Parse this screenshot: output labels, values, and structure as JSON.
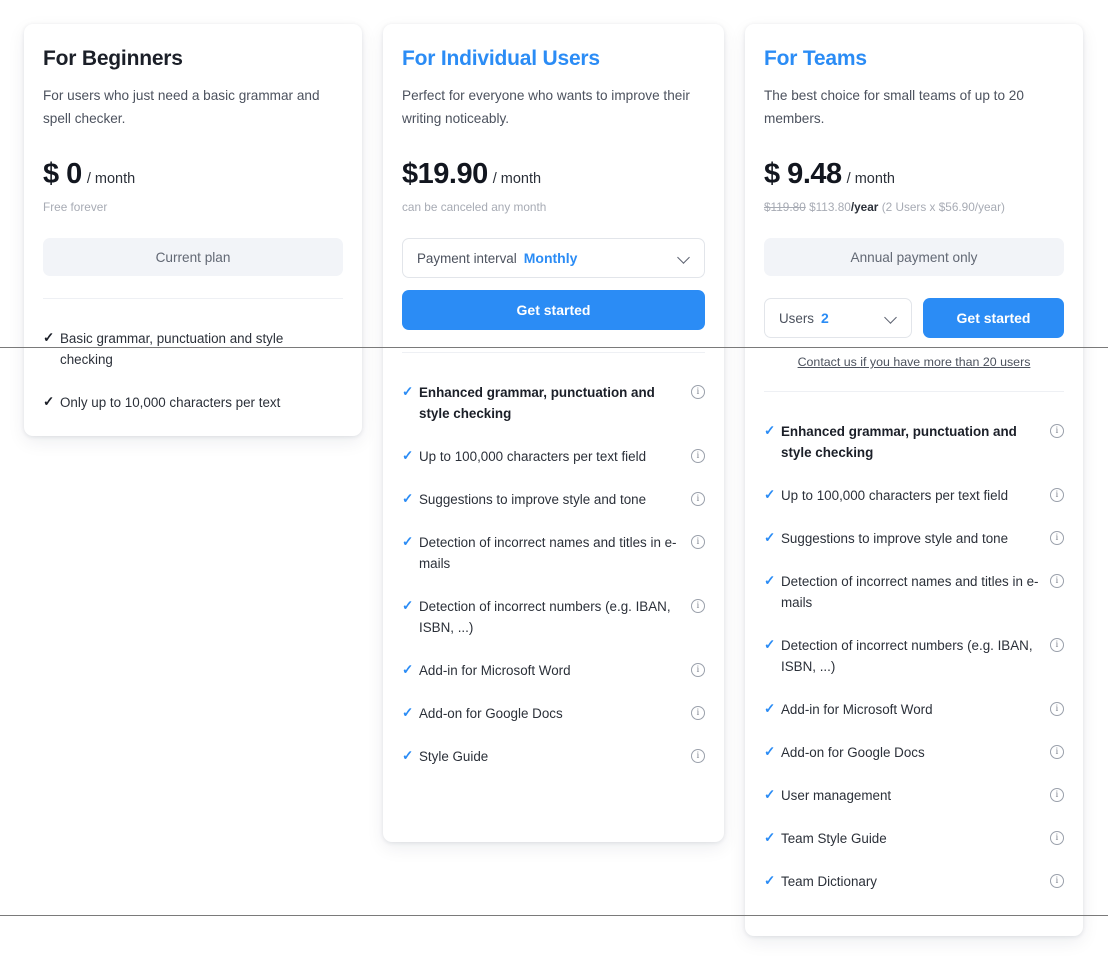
{
  "accent_color": "#2b8cf5",
  "plans": [
    {
      "id": "beginners",
      "title": "For Beginners",
      "description": "For users who just need a basic grammar and spell checker.",
      "price_main": "$ 0",
      "price_per": "/ month",
      "price_note": "Free forever",
      "cta_muted": "Current plan",
      "features": [
        {
          "text": "Basic grammar, punctuation and style checking",
          "bold": false,
          "info": false
        },
        {
          "text": "Only up to 10,000 characters per text",
          "bold": false,
          "info": false
        }
      ]
    },
    {
      "id": "individual",
      "title": "For Individual Users",
      "description": "Perfect for everyone who wants to improve their writing noticeably.",
      "price_main": "$19.90",
      "price_per": "/ month",
      "price_note": "can be canceled any month",
      "select_label": "Payment interval",
      "select_value": "Monthly",
      "cta_primary": "Get started",
      "features": [
        {
          "text": "Enhanced grammar, punctuation and style checking",
          "bold": true,
          "info": true
        },
        {
          "text": "Up to 100,000 characters per text field",
          "bold": false,
          "info": true
        },
        {
          "text": "Suggestions to improve style and tone",
          "bold": false,
          "info": true
        },
        {
          "text": "Detection of incorrect names and titles in e-mails",
          "bold": false,
          "info": true
        },
        {
          "text": "Detection of incorrect numbers (e.g. IBAN, ISBN, ...)",
          "bold": false,
          "info": true
        },
        {
          "text": "Add-in for Microsoft Word",
          "bold": false,
          "info": true
        },
        {
          "text": "Add-on for Google Docs",
          "bold": false,
          "info": true
        },
        {
          "text": "Style Guide",
          "bold": false,
          "info": true
        }
      ]
    },
    {
      "id": "teams",
      "title": "For Teams",
      "description": "The best choice for small teams of up to 20 members.",
      "price_main": "$ 9.48",
      "price_per": "/ month",
      "price_note_strike": "$119.80",
      "price_note_new": "$113.80",
      "price_note_unit": "/year",
      "price_note_detail": "(2 Users x $56.90/year)",
      "cta_muted": "Annual payment only",
      "select_label": "Users",
      "select_value": "2",
      "cta_primary": "Get started",
      "contact_link": "Contact us if you have more than 20 users",
      "features": [
        {
          "text": "Enhanced grammar, punctuation and style checking",
          "bold": true,
          "info": true
        },
        {
          "text": "Up to 100,000 characters per text field",
          "bold": false,
          "info": true
        },
        {
          "text": "Suggestions to improve style and tone",
          "bold": false,
          "info": true
        },
        {
          "text": "Detection of incorrect names and titles in e-mails",
          "bold": false,
          "info": true
        },
        {
          "text": "Detection of incorrect numbers (e.g. IBAN, ISBN, ...)",
          "bold": false,
          "info": true
        },
        {
          "text": "Add-in for Microsoft Word",
          "bold": false,
          "info": true
        },
        {
          "text": "Add-on for Google Docs",
          "bold": false,
          "info": true
        },
        {
          "text": "User management",
          "bold": false,
          "info": true
        },
        {
          "text": "Team Style Guide",
          "bold": false,
          "info": true
        },
        {
          "text": "Team Dictionary",
          "bold": false,
          "info": true
        }
      ]
    }
  ],
  "icons": {
    "check": "✓",
    "info": "i",
    "chevron": "chevron-down-icon"
  }
}
